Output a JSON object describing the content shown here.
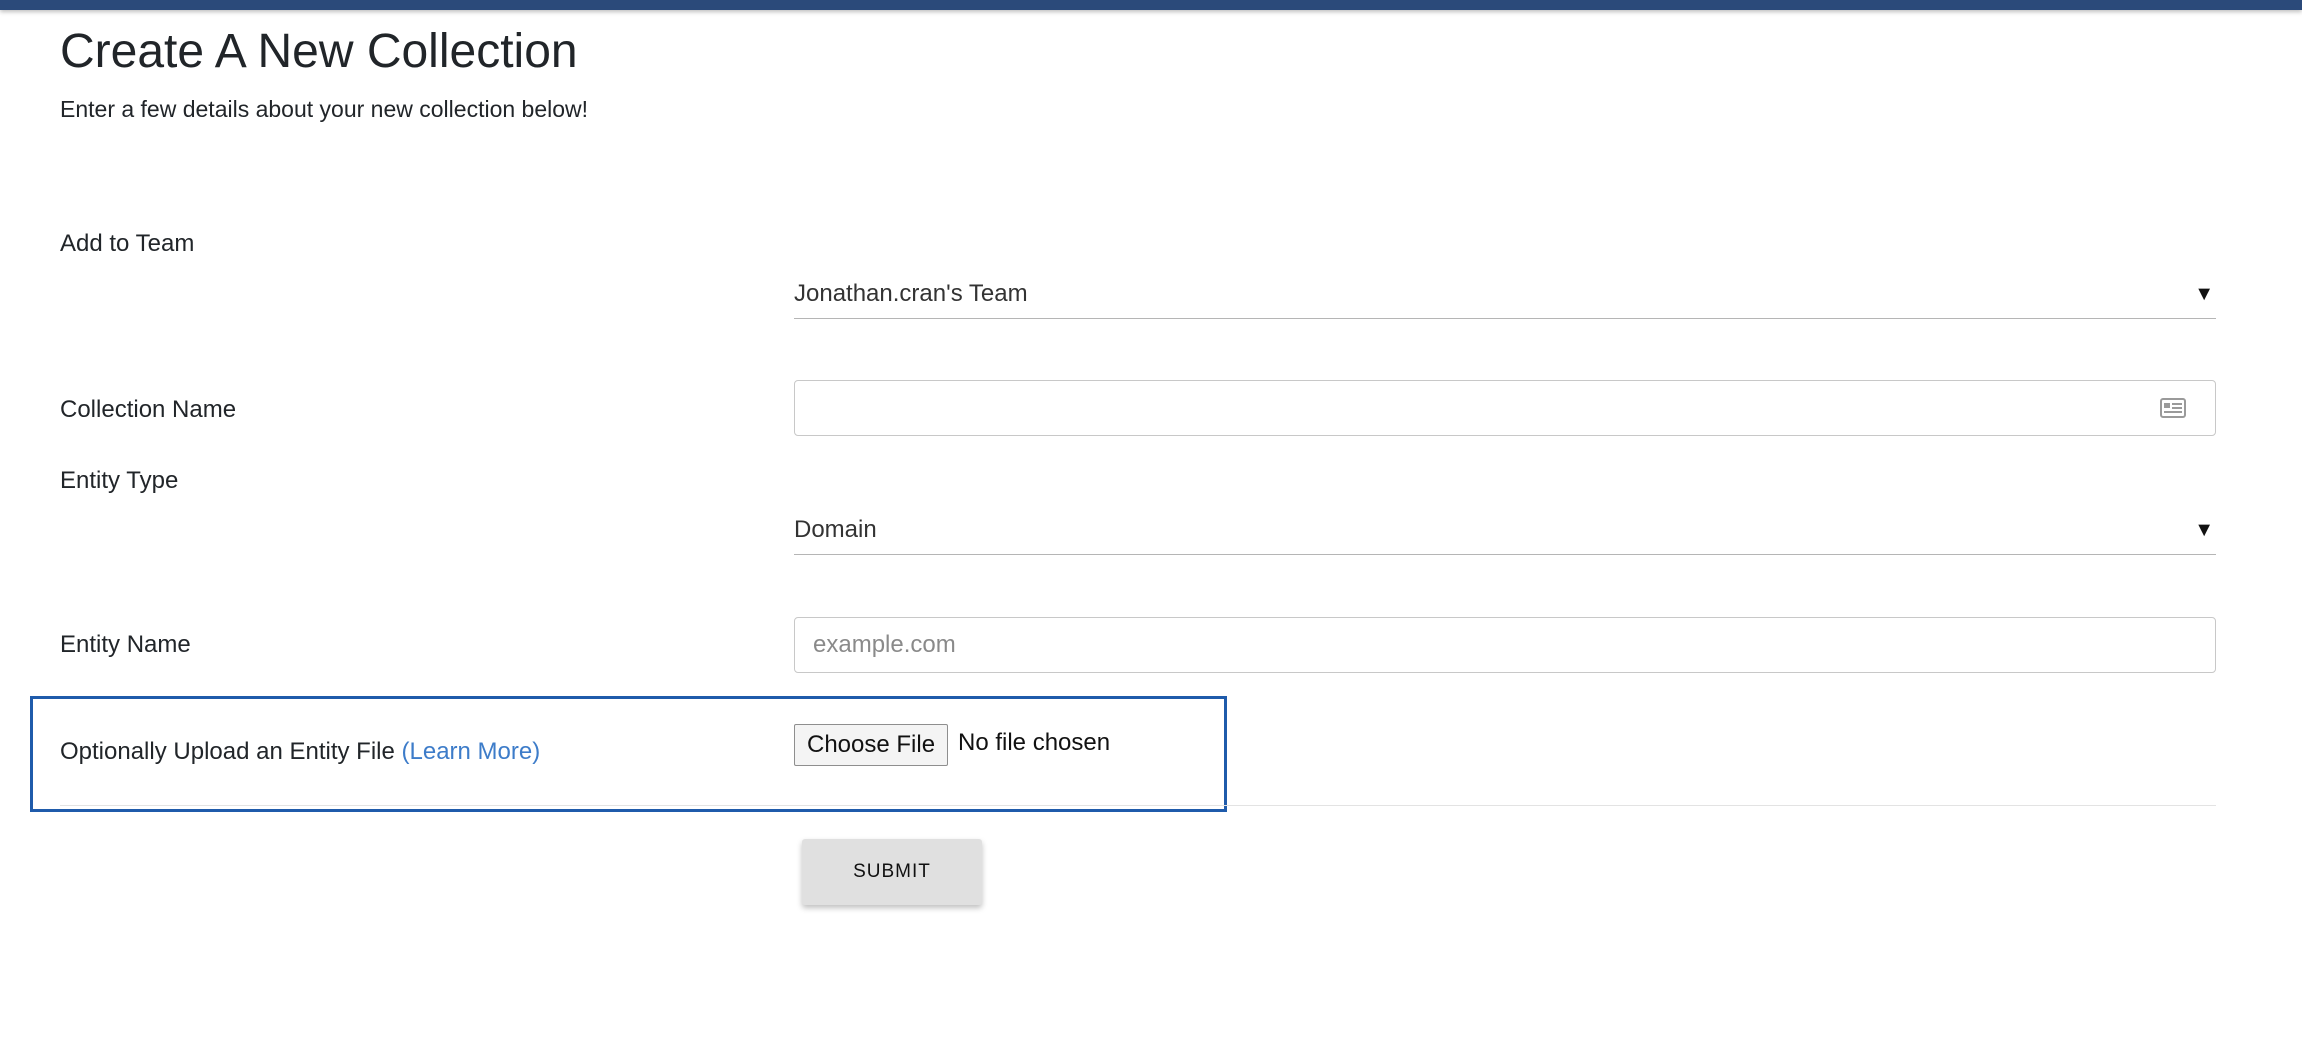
{
  "header": {
    "title": "Create A New Collection",
    "subtitle": "Enter a few details about your new collection below!"
  },
  "form": {
    "team": {
      "label": "Add to Team",
      "selected": "Jonathan.cran's Team",
      "arrow": "▼"
    },
    "collection_name": {
      "label": "Collection Name",
      "value": "",
      "placeholder": "",
      "icon": "id-card-icon"
    },
    "entity_type": {
      "label": "Entity Type",
      "selected": "Domain",
      "arrow": "▼"
    },
    "entity_name": {
      "label": "Entity Name",
      "value": "",
      "placeholder": "example.com"
    },
    "upload": {
      "label": "Optionally Upload an Entity File",
      "learn_more": "(Learn More)",
      "button_label": "Choose File",
      "status": "No file chosen"
    },
    "submit_label": "SUBMIT"
  },
  "colors": {
    "top_bar": "#2b4a7a",
    "highlight_border": "#1f5bab",
    "link": "#3d7cc9",
    "submit_bg": "#e0e0e0"
  }
}
